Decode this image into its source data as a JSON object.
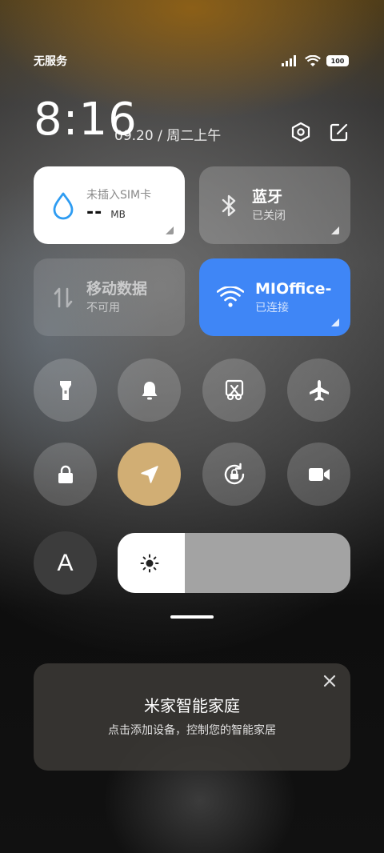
{
  "status_bar": {
    "carrier": "无服务",
    "battery": "100",
    "icons": [
      "signal-icon",
      "wifi-icon",
      "battery-icon"
    ]
  },
  "header": {
    "time": "8:16",
    "date": "09.20 / 周二上午",
    "buttons": [
      "settings-icon",
      "edit-icon"
    ]
  },
  "tiles": {
    "data": {
      "title": "未插入SIM卡",
      "value": "--",
      "unit": "MB"
    },
    "bluetooth": {
      "title": "蓝牙",
      "status": "已关闭"
    },
    "mobile_data": {
      "title": "移动数据",
      "status": "不可用"
    },
    "wifi": {
      "title": "MIOffice-",
      "status": "已连接"
    }
  },
  "toggles": {
    "row1": [
      "flashlight-icon",
      "bell-icon",
      "screenshot-icon",
      "airplane-icon"
    ],
    "row2": [
      "lock-icon",
      "location-icon",
      "rotation-lock-icon",
      "video-icon"
    ]
  },
  "auto_brightness_label": "A",
  "brightness": {
    "level_percent": 29
  },
  "colors": {
    "accent_blue": "#3f86f6",
    "active_gold": "#d1ae74"
  },
  "mijia_card": {
    "title": "米家智能家庭",
    "subtitle": "点击添加设备，控制您的智能家居"
  }
}
